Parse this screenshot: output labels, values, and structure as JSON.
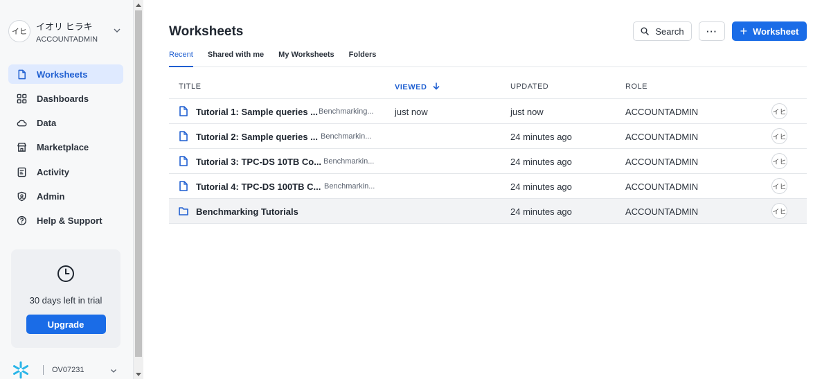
{
  "user": {
    "initials": "イヒ",
    "name": "イオリ ヒラキ",
    "role": "ACCOUNTADMIN"
  },
  "nav": [
    {
      "label": "Worksheets",
      "icon": "document-icon",
      "active": true
    },
    {
      "label": "Dashboards",
      "icon": "grid-icon"
    },
    {
      "label": "Data",
      "icon": "cloud-icon"
    },
    {
      "label": "Marketplace",
      "icon": "store-icon"
    },
    {
      "label": "Activity",
      "icon": "activity-icon"
    },
    {
      "label": "Admin",
      "icon": "shield-icon"
    },
    {
      "label": "Help & Support",
      "icon": "help-icon"
    }
  ],
  "trial": {
    "text": "30 days left in trial",
    "button": "Upgrade"
  },
  "footer": {
    "account": "OV07231"
  },
  "page": {
    "title": "Worksheets"
  },
  "actions": {
    "search": "Search",
    "more": "···",
    "new": "Worksheet"
  },
  "tabs": [
    {
      "label": "Recent",
      "active": true
    },
    {
      "label": "Shared with me"
    },
    {
      "label": "My Worksheets"
    },
    {
      "label": "Folders"
    }
  ],
  "table": {
    "headers": {
      "title": "TITLE",
      "viewed": "VIEWED",
      "updated": "UPDATED",
      "role": "ROLE"
    },
    "rows": [
      {
        "type": "worksheet",
        "title": "Tutorial 1: Sample queries ...",
        "folder": "Benchmarking...",
        "viewed": "just now",
        "updated": "just now",
        "role": "ACCOUNTADMIN",
        "owner": "イヒ"
      },
      {
        "type": "worksheet",
        "title": "Tutorial 2: Sample queries ...",
        "folder": "Benchmarkin...",
        "viewed": "",
        "updated": "24 minutes ago",
        "role": "ACCOUNTADMIN",
        "owner": "イヒ"
      },
      {
        "type": "worksheet",
        "title": "Tutorial 3: TPC-DS 10TB Co...",
        "folder": "Benchmarkin...",
        "viewed": "",
        "updated": "24 minutes ago",
        "role": "ACCOUNTADMIN",
        "owner": "イヒ"
      },
      {
        "type": "worksheet",
        "title": "Tutorial 4: TPC-DS 100TB C...",
        "folder": "Benchmarkin...",
        "viewed": "",
        "updated": "24 minutes ago",
        "role": "ACCOUNTADMIN",
        "owner": "イヒ"
      },
      {
        "type": "folder",
        "title": "Benchmarking Tutorials",
        "folder": "",
        "viewed": "",
        "updated": "24 minutes ago",
        "role": "ACCOUNTADMIN",
        "owner": "イヒ"
      }
    ]
  }
}
